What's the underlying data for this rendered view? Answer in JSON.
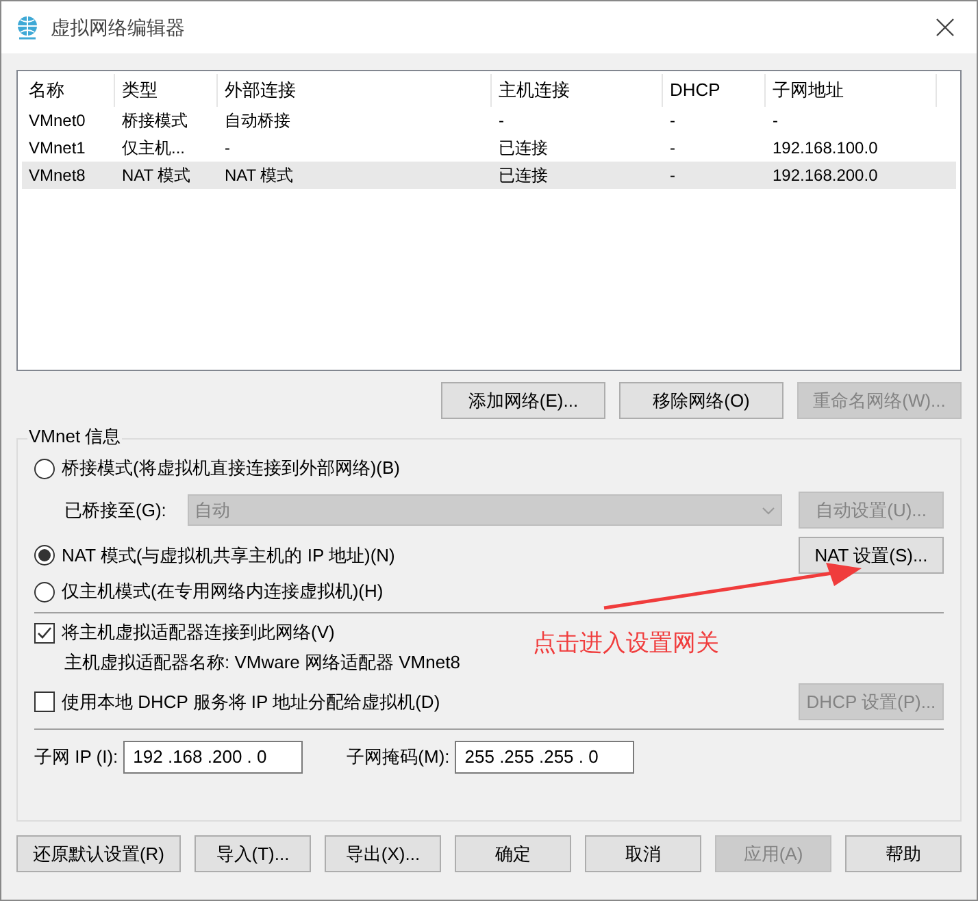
{
  "window": {
    "title": "虚拟网络编辑器"
  },
  "networks": {
    "columns": [
      "名称",
      "类型",
      "外部连接",
      "主机连接",
      "DHCP",
      "子网地址"
    ],
    "rows": [
      {
        "cells": [
          "VMnet0",
          "桥接模式",
          "自动桥接",
          "-",
          "-",
          "-"
        ],
        "selected": false
      },
      {
        "cells": [
          "VMnet1",
          "仅主机...",
          "-",
          "已连接",
          "-",
          "192.168.100.0"
        ],
        "selected": false
      },
      {
        "cells": [
          "VMnet8",
          "NAT 模式",
          "NAT 模式",
          "已连接",
          "-",
          "192.168.200.0"
        ],
        "selected": true
      }
    ]
  },
  "network_buttons": [
    {
      "label": "添加网络(E)...",
      "disabled": false
    },
    {
      "label": "移除网络(O)",
      "disabled": false
    },
    {
      "label": "重命名网络(W)...",
      "disabled": true
    }
  ],
  "vmnet_info": {
    "title": "VMnet 信息",
    "modes": [
      {
        "label": "桥接模式(将虚拟机直接连接到外部网络)(B)",
        "selected": false
      },
      {
        "label": "NAT 模式(与虚拟机共享主机的 IP 地址)(N)",
        "selected": true
      },
      {
        "label": "仅主机模式(在专用网络内连接虚拟机)(H)",
        "selected": false
      }
    ],
    "bridged_to": {
      "label": "已桥接至(G):",
      "value": "自动",
      "disabled": true
    },
    "auto_settings": {
      "label": "自动设置(U)...",
      "disabled": true
    },
    "nat_settings": {
      "label": "NAT 设置(S)...",
      "disabled": false
    },
    "connect_adapter": {
      "label": "将主机虚拟适配器连接到此网络(V)",
      "checked": true
    },
    "adapter_name": "主机虚拟适配器名称: VMware 网络适配器 VMnet8",
    "use_dhcp": {
      "label": "使用本地 DHCP 服务将 IP 地址分配给虚拟机(D)",
      "checked": false
    },
    "dhcp_settings": {
      "label": "DHCP 设置(P)...",
      "disabled": true
    },
    "subnet_ip": {
      "label": "子网 IP (I):",
      "value": "192 .168 .200 . 0"
    },
    "subnet_mask": {
      "label": "子网掩码(M):",
      "value": "255 .255 .255 . 0"
    }
  },
  "annotation": "点击进入设置网关",
  "footer_buttons": [
    {
      "label": "还原默认设置(R)",
      "disabled": false
    },
    {
      "label": "导入(T)...",
      "disabled": false
    },
    {
      "label": "导出(X)...",
      "disabled": false
    },
    {
      "label": "确定",
      "disabled": false
    },
    {
      "label": "取消",
      "disabled": false
    },
    {
      "label": "应用(A)",
      "disabled": true
    },
    {
      "label": "帮助",
      "disabled": false
    }
  ]
}
